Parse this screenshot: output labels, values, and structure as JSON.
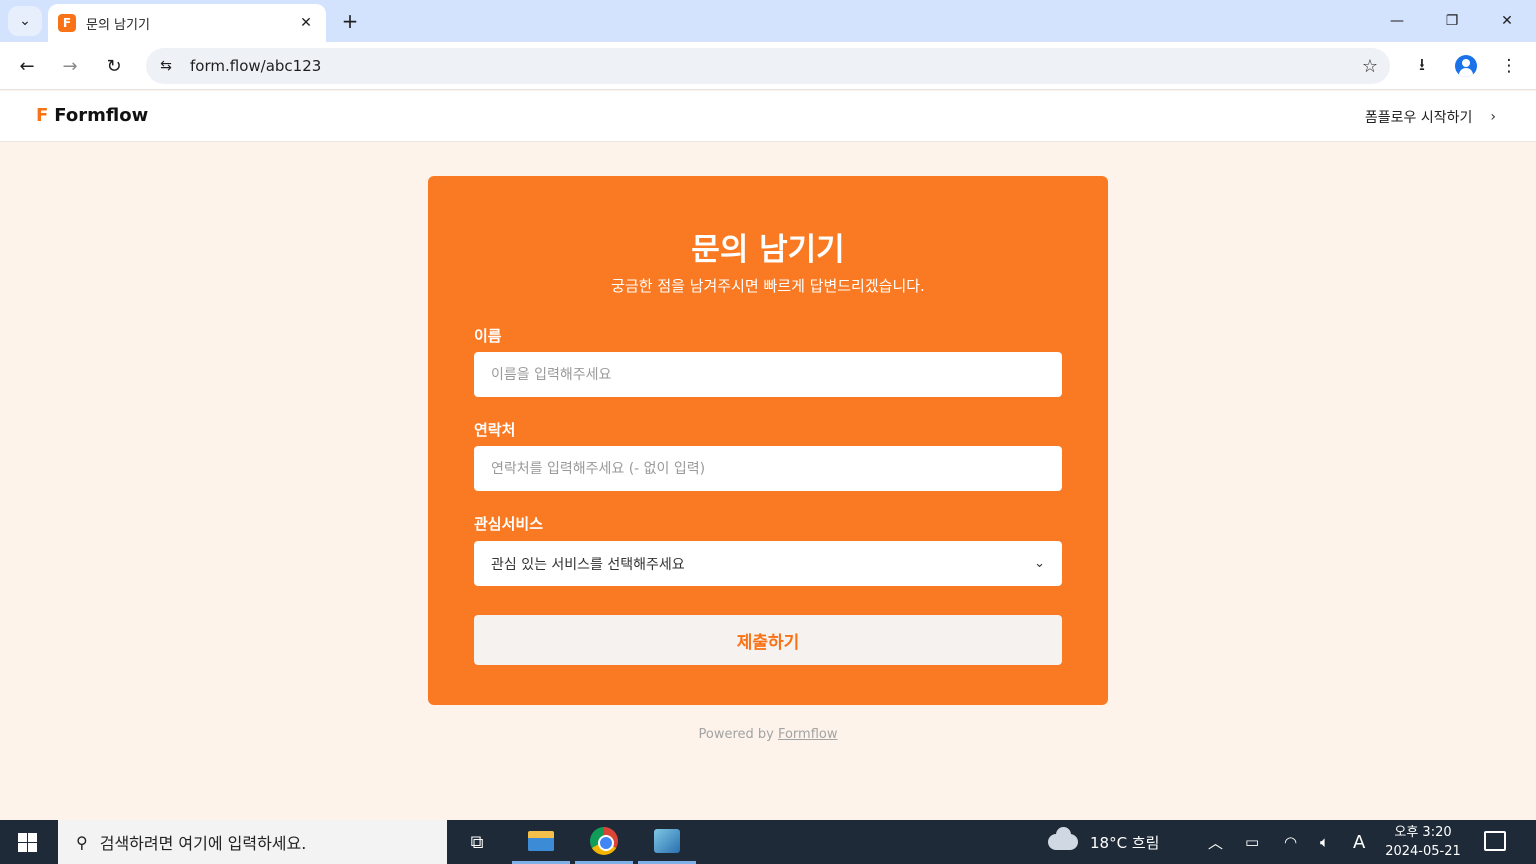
{
  "browser": {
    "tab_title": "문의 남기기",
    "tab_favicon": "F",
    "url": "form.flow/abc123"
  },
  "site": {
    "logo_mark": "F",
    "logo_text": "Formflow",
    "start_link": "폼플로우 시작하기"
  },
  "form": {
    "title": "문의 남기기",
    "subtitle": "궁금한 점을 남겨주시면 빠르게 답변드리겠습니다.",
    "fields": [
      {
        "label": "이름",
        "placeholder": "이름을 입력해주세요"
      },
      {
        "label": "연락처",
        "placeholder": "연락처를 입력해주세요 (- 없이 입력)"
      },
      {
        "label": "관심서비스",
        "placeholder": "관심 있는 서비스를 선택해주세요"
      }
    ],
    "submit_label": "제출하기"
  },
  "footer": {
    "powered_prefix": "Powered by ",
    "powered_link": "Formflow"
  },
  "taskbar": {
    "search_placeholder": "검색하려면 여기에 입력하세요.",
    "weather": "18°C 흐림",
    "ime": "A",
    "time": "오후 3:20",
    "date": "2024-05-21"
  },
  "colors": {
    "accent": "#f97a22",
    "page_bg": "#fdf3ea",
    "tabbar_bg": "#d3e3fd",
    "taskbar_bg": "#1e2a38"
  }
}
